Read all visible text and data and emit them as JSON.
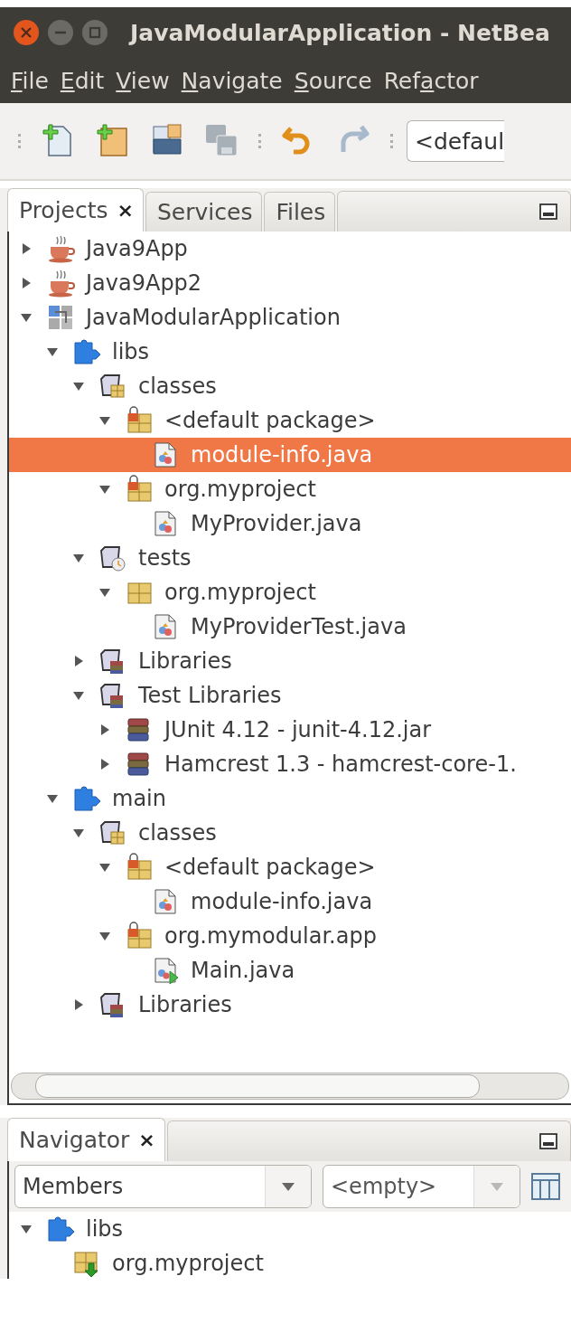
{
  "window": {
    "title": "JavaModularApplication - NetBea"
  },
  "menu": [
    {
      "key": "F",
      "after": "ile"
    },
    {
      "key": "E",
      "after": "dit"
    },
    {
      "key": "V",
      "after": "iew"
    },
    {
      "key": "N",
      "after": "avigate"
    },
    {
      "key": "S",
      "after": "ource"
    },
    {
      "before": "Ref",
      "key": "a",
      "after": "ctor"
    }
  ],
  "toolbar": {
    "buttons": [
      {
        "kind": "new-file",
        "disabled": false
      },
      {
        "kind": "new-project",
        "disabled": false
      },
      {
        "kind": "open-project",
        "disabled": false
      },
      {
        "kind": "save-all",
        "disabled": true
      },
      {
        "kind": "undo",
        "disabled": false
      },
      {
        "kind": "redo",
        "disabled": true
      }
    ],
    "config_combo": {
      "value": "<defaul"
    }
  },
  "projects_panel": {
    "tabs": [
      {
        "label": "Projects",
        "selected": true,
        "close": "×"
      },
      {
        "label": "Services",
        "selected": false
      },
      {
        "label": "Files",
        "selected": false
      }
    ],
    "tree": [
      {
        "label": "Java9App",
        "kind": "java-project",
        "expanded": false,
        "selected": false
      },
      {
        "label": "Java9App2",
        "kind": "java-project",
        "expanded": false,
        "selected": false
      },
      {
        "label": "JavaModularApplication",
        "kind": "modular-project",
        "expanded": true,
        "selected": false,
        "children": [
          {
            "label": "libs",
            "kind": "module",
            "expanded": true,
            "selected": false,
            "children": [
              {
                "label": "classes",
                "kind": "source-root",
                "expanded": true,
                "selected": false,
                "children": [
                  {
                    "label": "<default package>",
                    "kind": "locked-package",
                    "expanded": true,
                    "selected": false,
                    "children": [
                      {
                        "label": "module-info.java",
                        "kind": "java-file",
                        "selected": true
                      }
                    ]
                  },
                  {
                    "label": "org.myproject",
                    "kind": "locked-package",
                    "expanded": true,
                    "selected": false,
                    "children": [
                      {
                        "label": "MyProvider.java",
                        "kind": "java-file",
                        "selected": false
                      }
                    ]
                  }
                ]
              },
              {
                "label": "tests",
                "kind": "test-root",
                "expanded": true,
                "selected": false,
                "children": [
                  {
                    "label": "org.myproject",
                    "kind": "package",
                    "expanded": true,
                    "selected": false,
                    "children": [
                      {
                        "label": "MyProviderTest.java",
                        "kind": "java-file",
                        "selected": false
                      }
                    ]
                  }
                ]
              },
              {
                "label": "Libraries",
                "kind": "libraries",
                "expanded": false,
                "selected": false
              },
              {
                "label": "Test Libraries",
                "kind": "libraries",
                "expanded": true,
                "selected": false,
                "children": [
                  {
                    "label": "JUnit 4.12 - junit-4.12.jar",
                    "kind": "jar",
                    "expanded": false,
                    "selected": false
                  },
                  {
                    "label": "Hamcrest 1.3 - hamcrest-core-1.",
                    "kind": "jar",
                    "expanded": false,
                    "selected": false
                  }
                ]
              }
            ]
          },
          {
            "label": "main",
            "kind": "module",
            "expanded": true,
            "selected": false,
            "children": [
              {
                "label": "classes",
                "kind": "source-root",
                "expanded": true,
                "selected": false,
                "children": [
                  {
                    "label": "<default package>",
                    "kind": "locked-package",
                    "expanded": true,
                    "selected": false,
                    "children": [
                      {
                        "label": "module-info.java",
                        "kind": "java-file",
                        "selected": false
                      }
                    ]
                  },
                  {
                    "label": "org.mymodular.app",
                    "kind": "locked-package",
                    "expanded": true,
                    "selected": false,
                    "children": [
                      {
                        "label": "Main.java",
                        "kind": "main-java-file",
                        "selected": false
                      }
                    ]
                  }
                ]
              },
              {
                "label": "Libraries",
                "kind": "libraries",
                "expanded": false,
                "selected": false
              }
            ]
          }
        ]
      }
    ]
  },
  "navigator_panel": {
    "tabs": [
      {
        "label": "Navigator",
        "selected": true,
        "close": "×"
      }
    ],
    "members_combo": {
      "value": "Members",
      "disabled": false
    },
    "filter_combo": {
      "value": "<empty>",
      "disabled": true
    },
    "tree": [
      {
        "label": "libs",
        "kind": "module",
        "expanded": true,
        "selected": false,
        "children": [
          {
            "label": "org.myproject",
            "kind": "exported-package",
            "selected": false
          }
        ]
      }
    ]
  }
}
